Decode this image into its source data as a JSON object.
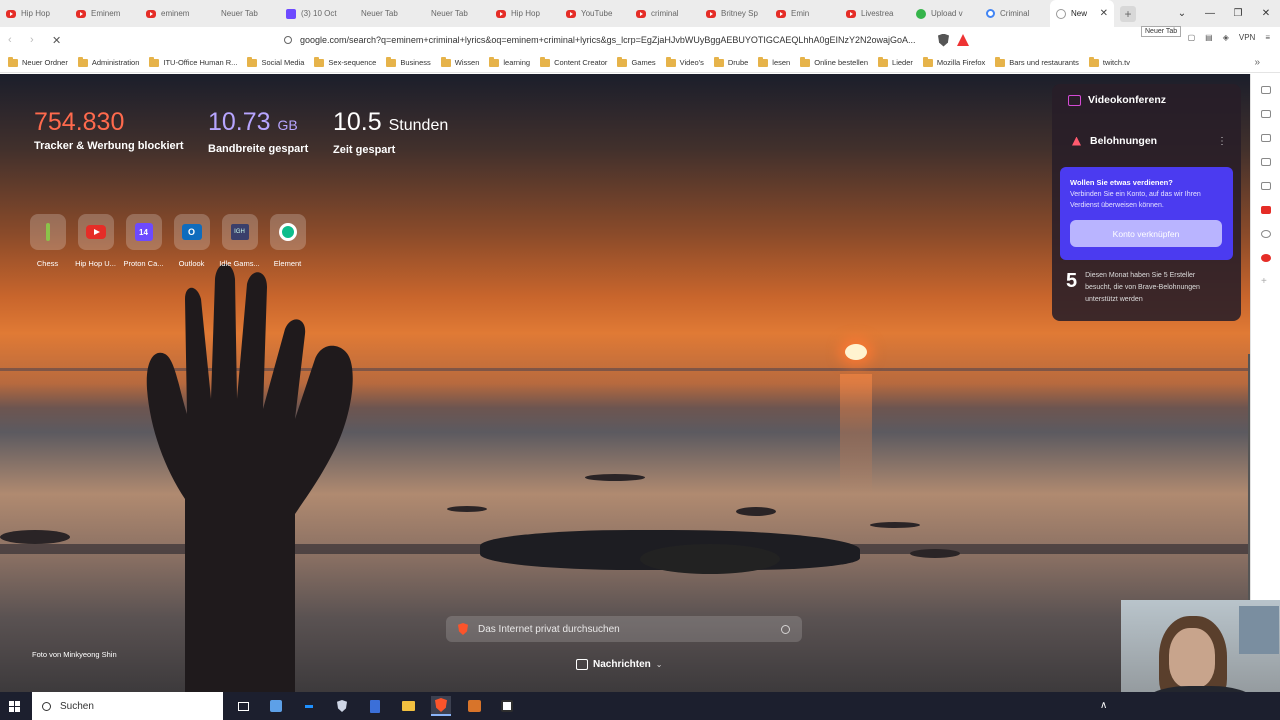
{
  "tabs": [
    {
      "label": "Hip Hop",
      "icon": "youtube-icon"
    },
    {
      "label": "Eminem",
      "icon": "youtube-icon"
    },
    {
      "label": "eminem",
      "icon": "youtube-icon"
    },
    {
      "label": "Neuer Tab",
      "icon": "blank-icon"
    },
    {
      "label": "(3) 10 Oct",
      "icon": "proton-icon"
    },
    {
      "label": "Neuer Tab",
      "icon": "blank-icon"
    },
    {
      "label": "Neuer Tab",
      "icon": "blank-icon"
    },
    {
      "label": "Hip Hop",
      "icon": "youtube-icon"
    },
    {
      "label": "YouTube",
      "icon": "youtube-icon"
    },
    {
      "label": "criminal",
      "icon": "youtube-icon"
    },
    {
      "label": "Britney Sp",
      "icon": "youtube-icon"
    },
    {
      "label": "Emin",
      "icon": "youtube-icon"
    },
    {
      "label": "Livestrea",
      "icon": "youtube-icon"
    },
    {
      "label": "Upload v",
      "icon": "green-icon"
    },
    {
      "label": "Criminal",
      "icon": "google-icon"
    }
  ],
  "active_tab": {
    "label": "New",
    "close": "✕"
  },
  "new_tab_button": "+",
  "new_tab_tooltip": "Neuer Tab",
  "window_controls": {
    "chevron": "⌄",
    "minimize": "—",
    "restore": "❐",
    "close": "✕"
  },
  "toolbar": {
    "back": "‹",
    "forward": "›",
    "reload": "✕",
    "url": "google.com/search?q=eminem+criminal+lyrics&oq=eminem+criminal+lyrics&gs_lcrp=EgZjaHJvbWUyBggAEBUYOTIGCAEQLhhA0gEINzY2N2owajGoA...",
    "vpn_label": "VPN"
  },
  "bookmarks": [
    "Neuer Ordner",
    "Administration",
    "ITU-Office Human R...",
    "Social Media",
    "Sex-sequence",
    "Business",
    "Wissen",
    "learning",
    "Content Creator",
    "Games",
    "Video's",
    "Drube",
    "lesen",
    "Online bestellen",
    "Lieder",
    "Mozilla Firefox",
    "Bars und restaurants",
    "twitch.tv"
  ],
  "bookmarks_more": "»",
  "stats": {
    "trackers": {
      "value": "754.830",
      "label": "Tracker & Werbung blockiert"
    },
    "bandwidth": {
      "value": "10.73",
      "unit": "GB",
      "label": "Bandbreite gespart"
    },
    "time": {
      "value": "10.5",
      "unit": "Stunden",
      "label": "Zeit gespart"
    }
  },
  "shortcuts": [
    {
      "label": "Chess",
      "icon": "chess-icon"
    },
    {
      "label": "Hip Hop U...",
      "icon": "youtube-icon"
    },
    {
      "label": "Proton Ca...",
      "icon": "proton-calendar-icon",
      "glyph": "14"
    },
    {
      "label": "Outlook",
      "icon": "outlook-icon",
      "glyph": "O"
    },
    {
      "label": "Idle Gams...",
      "icon": "idle-games-icon",
      "glyph": "IGH"
    },
    {
      "label": "Element",
      "icon": "element-icon"
    }
  ],
  "photo_credit": "Foto von Minkyeong Shin",
  "search": {
    "placeholder": "Das Internet privat durchsuchen"
  },
  "news": {
    "label": "Nachrichten",
    "chevron": "⌄"
  },
  "panel": {
    "video_conference": "Videokonferenz",
    "rewards_title": "Belohnungen",
    "rewards_menu": "⋮",
    "card_question": "Wollen Sie etwas verdienen?",
    "card_desc": "Verbinden Sie ein Konto, auf das wir Ihren Verdienst überweisen können.",
    "card_button": "Konto verknüpfen",
    "creators_count": "5",
    "creators_text": "Diesen Monat haben Sie 5 Ersteller besucht, die von Brave-Belohnungen unterstützt werden"
  },
  "taskbar": {
    "search_label": "Suchen",
    "tray_chevron": "∧"
  }
}
